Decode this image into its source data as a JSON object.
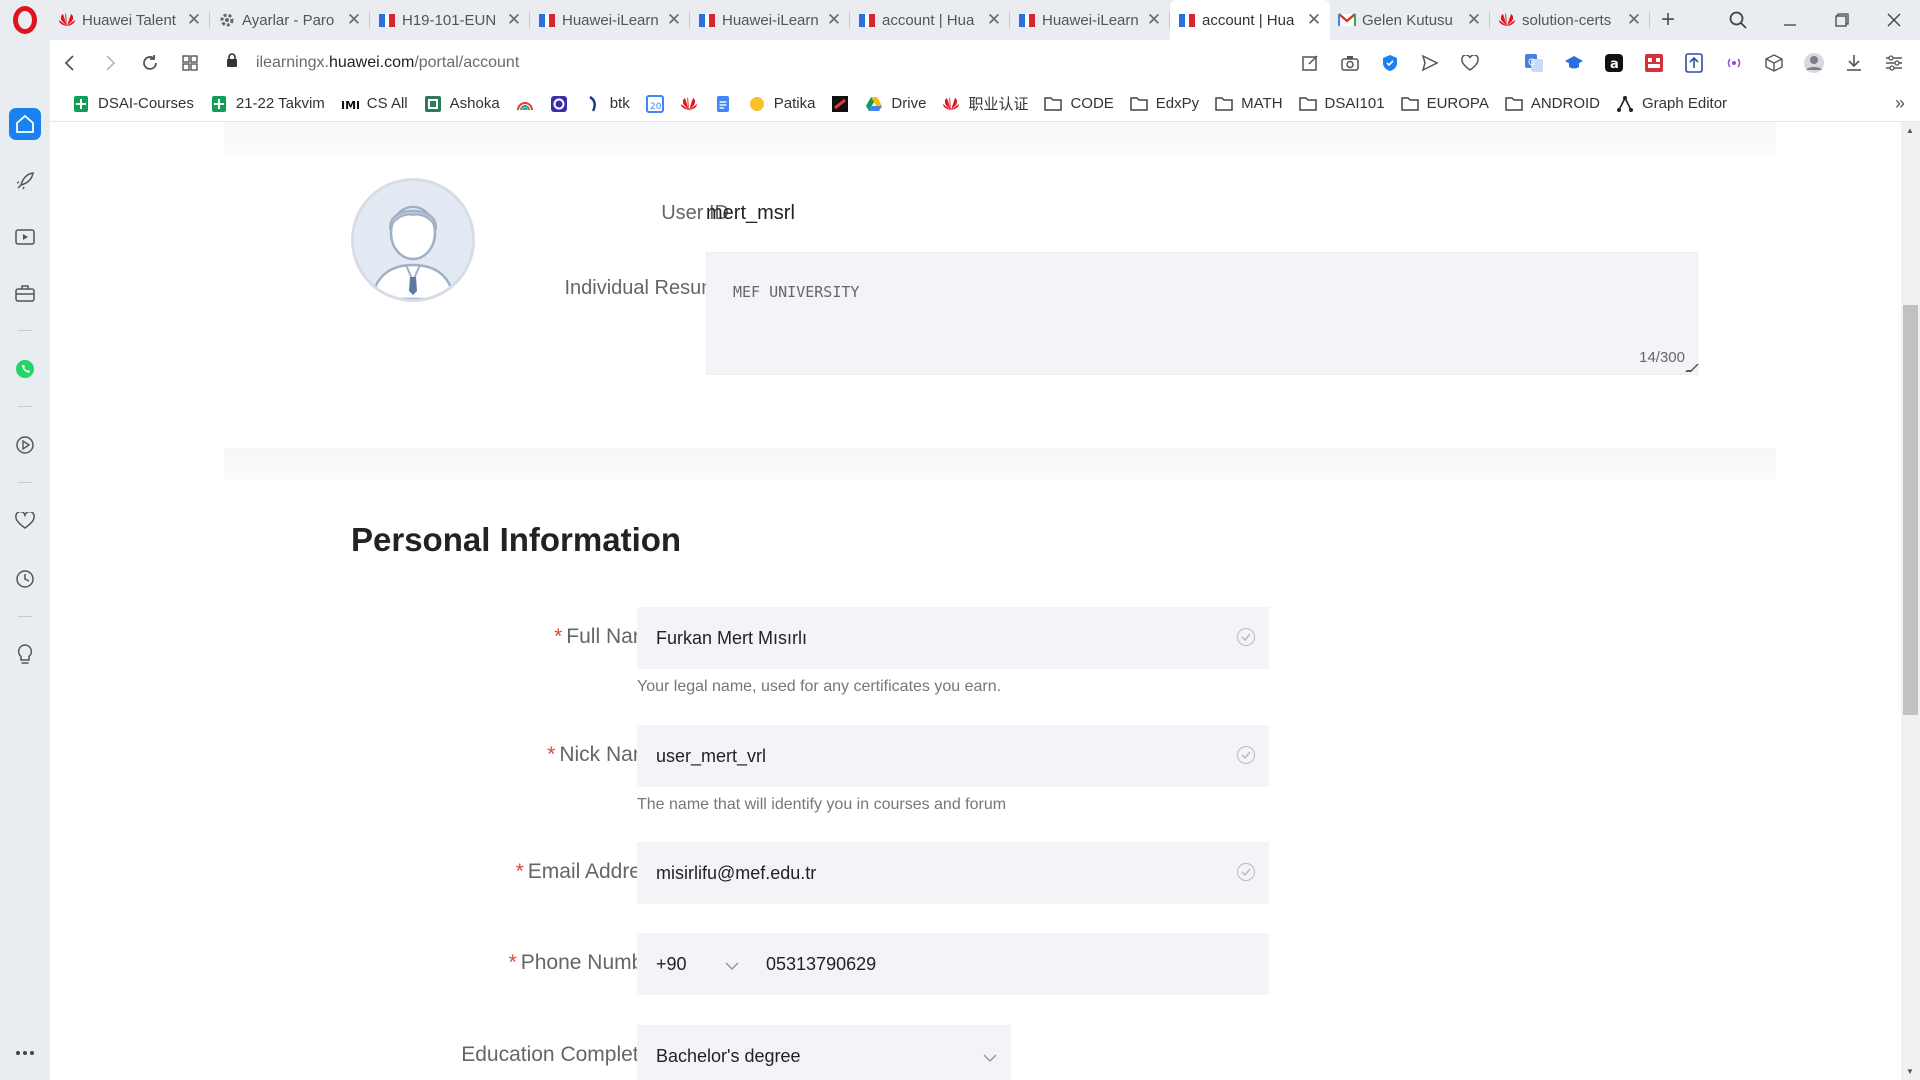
{
  "browser": {
    "tabs": [
      {
        "title": "Huawei Talent",
        "icon": "huawei-icon",
        "active": false
      },
      {
        "title": "Ayarlar - Paro",
        "icon": "gear-icon",
        "active": false
      },
      {
        "title": "H19-101-EUN",
        "icon": "ilearning-icon",
        "active": false
      },
      {
        "title": "Huawei-iLearn",
        "icon": "ilearning-icon",
        "active": false
      },
      {
        "title": "Huawei-iLearn",
        "icon": "ilearning-icon",
        "active": false
      },
      {
        "title": "account | Hua",
        "icon": "ilearning-icon",
        "active": false
      },
      {
        "title": "Huawei-iLearn",
        "icon": "ilearning-icon",
        "active": false
      },
      {
        "title": "account | Hua",
        "icon": "ilearning-icon",
        "active": true
      },
      {
        "title": "Gelen Kutusu",
        "icon": "gmail-icon",
        "active": false
      },
      {
        "title": "solution-certs",
        "icon": "huawei-icon",
        "active": false
      }
    ],
    "url": {
      "prefix": "ilearningx.",
      "host": "huawei.com",
      "path": "/portal/account"
    },
    "bookmarks": [
      {
        "label": "DSAI-Courses",
        "icon": "sheets-icon"
      },
      {
        "label": "21-22 Takvim",
        "icon": "sheets-icon"
      },
      {
        "label": "CS All",
        "icon": "iml-icon"
      },
      {
        "label": "Ashoka",
        "icon": "ashoka-icon"
      },
      {
        "label": "",
        "icon": "rainbow-icon"
      },
      {
        "label": "",
        "icon": "circle-app-icon"
      },
      {
        "label": "btk",
        "icon": "btk-icon"
      },
      {
        "label": "",
        "icon": "calendar-icon"
      },
      {
        "label": "",
        "icon": "huawei-icon"
      },
      {
        "label": "",
        "icon": "docs-icon"
      },
      {
        "label": "Patika",
        "icon": "patika-icon"
      },
      {
        "label": "",
        "icon": "app-icon"
      },
      {
        "label": "Drive",
        "icon": "drive-icon"
      },
      {
        "label": "职业认证",
        "icon": "huawei-icon"
      },
      {
        "label": "CODE",
        "icon": "folder-icon"
      },
      {
        "label": "EdxPy",
        "icon": "folder-icon"
      },
      {
        "label": "MATH",
        "icon": "folder-icon"
      },
      {
        "label": "DSAI101",
        "icon": "folder-icon"
      },
      {
        "label": "EUROPA",
        "icon": "folder-icon"
      },
      {
        "label": "ANDROID",
        "icon": "folder-icon"
      },
      {
        "label": "Graph Editor",
        "icon": "graph-icon"
      }
    ],
    "accent": "#1a82f0"
  },
  "profile": {
    "user_id_label": "User ID",
    "user_id": "mert_msrl",
    "resume_label": "Individual Resume",
    "resume_text": "MEF UNIVERSITY",
    "resume_count": "14/300"
  },
  "personal": {
    "title": "Personal Information",
    "required_mark": "*",
    "full_name": {
      "label": "Full Name",
      "value": "Furkan Mert Mısırlı",
      "hint": "Your legal name, used for any certificates you earn."
    },
    "nick_name": {
      "label": "Nick Name",
      "value": "user_mert_vrl",
      "hint": "The name that will identify you in courses and forum"
    },
    "email": {
      "label": "Email Address",
      "value": "misirlifu@mef.edu.tr"
    },
    "phone": {
      "label": "Phone Number",
      "code": "+90",
      "value": "05313790629"
    },
    "education": {
      "label": "Education Completed",
      "value": "Bachelor's degree"
    }
  },
  "colors": {
    "required": "#e0473e",
    "field_bg": "#f3f4f7"
  }
}
